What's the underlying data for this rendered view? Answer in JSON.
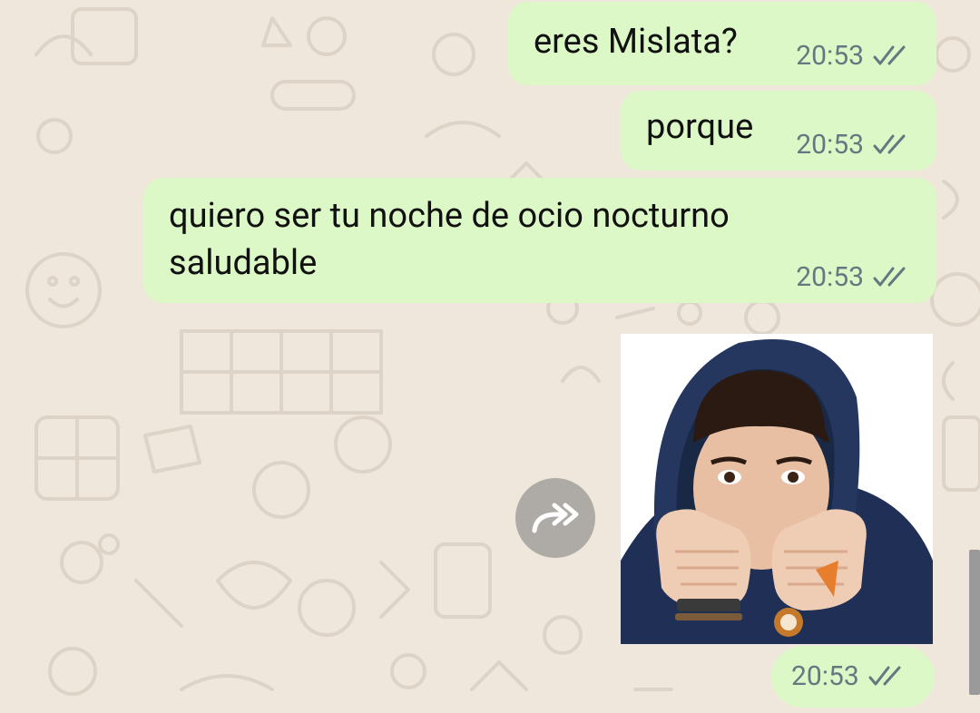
{
  "chat": {
    "messages": [
      {
        "text": "eres Mislata?",
        "time": "20:53"
      },
      {
        "text": "porque",
        "time": "20:53"
      },
      {
        "text": "quiero ser tu noche de ocio nocturno\nsaludable",
        "time": "20:53"
      },
      {
        "type": "sticker",
        "time": "20:53"
      }
    ]
  },
  "colors": {
    "background": "#efe7dc",
    "outgoing_bubble": "#dcf8c6",
    "meta_text": "#667781",
    "read_ticks": "#667781"
  },
  "icons": {
    "forward": "forward-icon",
    "ticks": "double-check-icon"
  }
}
